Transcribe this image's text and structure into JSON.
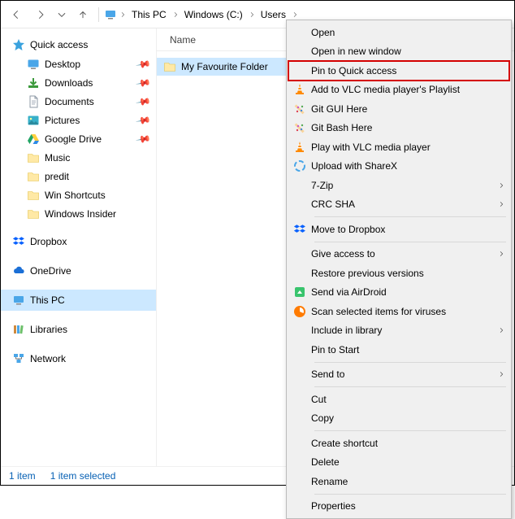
{
  "toolbar": {
    "breadcrumb": [
      "This PC",
      "Windows (C:)",
      "Users"
    ],
    "breadcrumb_truncated": true
  },
  "nav": {
    "quick_access_label": "Quick access",
    "quick_items": [
      {
        "label": "Desktop",
        "icon": "desktop",
        "pinned": true
      },
      {
        "label": "Downloads",
        "icon": "downloads",
        "pinned": true
      },
      {
        "label": "Documents",
        "icon": "documents",
        "pinned": true
      },
      {
        "label": "Pictures",
        "icon": "pictures",
        "pinned": true
      },
      {
        "label": "Google Drive",
        "icon": "gdrive",
        "pinned": true
      },
      {
        "label": "Music",
        "icon": "folder",
        "pinned": false
      },
      {
        "label": "predit",
        "icon": "folder",
        "pinned": false
      },
      {
        "label": "Win Shortcuts",
        "icon": "folder",
        "pinned": false
      },
      {
        "label": "Windows Insider",
        "icon": "folder",
        "pinned": false
      }
    ],
    "roots": [
      {
        "label": "Dropbox",
        "icon": "dropbox"
      },
      {
        "label": "OneDrive",
        "icon": "onedrive"
      },
      {
        "label": "This PC",
        "icon": "thispc",
        "selected": true
      },
      {
        "label": "Libraries",
        "icon": "libraries"
      },
      {
        "label": "Network",
        "icon": "network"
      }
    ]
  },
  "content": {
    "column_header": "Name",
    "items": [
      {
        "label": "My Favourite Folder",
        "icon": "folder",
        "selected": true
      }
    ]
  },
  "status": {
    "count": "1 item",
    "selection": "1 item selected"
  },
  "context_menu": {
    "groups": [
      [
        {
          "label": "Open"
        },
        {
          "label": "Open in new window"
        },
        {
          "label": "Pin to Quick access",
          "highlight": true
        },
        {
          "label": "Add to VLC media player's Playlist",
          "icon": "vlc"
        },
        {
          "label": "Git GUI Here",
          "icon": "git"
        },
        {
          "label": "Git Bash Here",
          "icon": "git"
        },
        {
          "label": "Play with VLC media player",
          "icon": "vlc"
        },
        {
          "label": "Upload with ShareX",
          "icon": "sharex"
        },
        {
          "label": "7-Zip",
          "submenu": true
        },
        {
          "label": "CRC SHA",
          "submenu": true
        }
      ],
      [
        {
          "label": "Move to Dropbox",
          "icon": "dropbox"
        }
      ],
      [
        {
          "label": "Give access to",
          "submenu": true
        },
        {
          "label": "Restore previous versions"
        },
        {
          "label": "Send via AirDroid",
          "icon": "airdroid"
        },
        {
          "label": "Scan selected items for viruses",
          "icon": "avast"
        },
        {
          "label": "Include in library",
          "submenu": true
        },
        {
          "label": "Pin to Start"
        }
      ],
      [
        {
          "label": "Send to",
          "submenu": true
        }
      ],
      [
        {
          "label": "Cut"
        },
        {
          "label": "Copy"
        }
      ],
      [
        {
          "label": "Create shortcut"
        },
        {
          "label": "Delete"
        },
        {
          "label": "Rename"
        }
      ],
      [
        {
          "label": "Properties"
        }
      ]
    ]
  }
}
